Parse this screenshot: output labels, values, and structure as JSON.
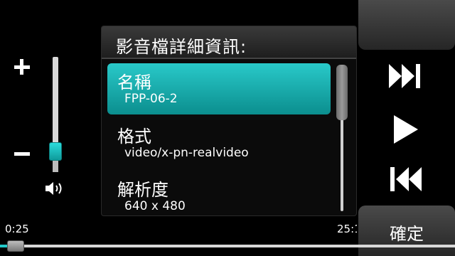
{
  "dialog": {
    "title": "影音檔詳細資訊:",
    "items": [
      {
        "label": "名稱",
        "value": "FPP-06-2"
      },
      {
        "label": "格式",
        "value": "video/x-pn-realvideo"
      },
      {
        "label": "解析度",
        "value": "640 x 480"
      }
    ]
  },
  "player": {
    "elapsed": "0:25",
    "total": "25:1",
    "progress_fraction": 0.016,
    "volume_fraction": 0.2
  },
  "controls": {
    "ok_label": "確定",
    "icons": [
      "fast-forward-icon",
      "play-icon",
      "rewind-icon",
      "speaker-icon",
      "plus-icon",
      "minus-icon"
    ]
  },
  "colors": {
    "accent": "#1fb5b5",
    "background": "#000000"
  }
}
